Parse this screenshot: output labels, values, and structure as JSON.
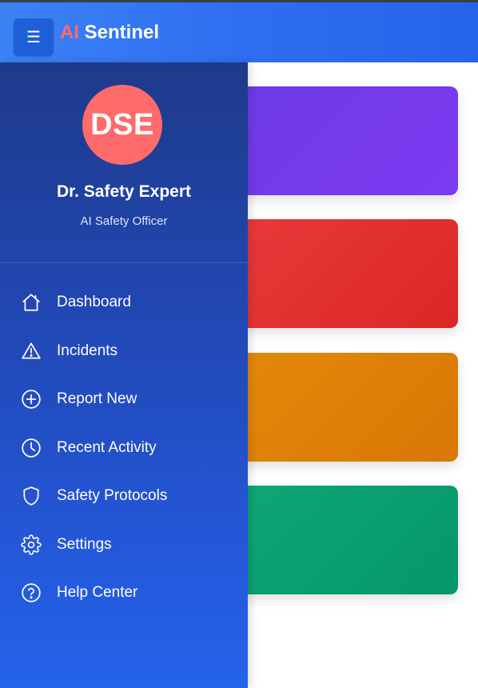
{
  "header": {
    "menu_glyph": "☰",
    "brand_accent": "AI",
    "brand_text": " Sentinel"
  },
  "profile": {
    "initials": "DSE",
    "name": "Dr. Safety Expert",
    "role": "AI Safety Officer"
  },
  "nav": {
    "items": [
      {
        "label": "Dashboard",
        "icon": "home-icon"
      },
      {
        "label": "Incidents",
        "icon": "warning-triangle-icon"
      },
      {
        "label": "Report New",
        "icon": "plus-circle-icon"
      },
      {
        "label": "Recent Activity",
        "icon": "clock-icon"
      },
      {
        "label": "Safety Protocols",
        "icon": "shield-icon"
      },
      {
        "label": "Settings",
        "icon": "gear-icon"
      },
      {
        "label": "Help Center",
        "icon": "help-circle-icon"
      }
    ]
  },
  "colors": {
    "brand_accent": "#ff6b6b",
    "header": "#2f6ef0",
    "sidebar_top": "#1e3a8a",
    "sidebar_bottom": "#2563eb",
    "card_purple": "#7b3af0",
    "card_red": "#dc2626",
    "card_orange": "#d97706",
    "card_green": "#059669"
  }
}
